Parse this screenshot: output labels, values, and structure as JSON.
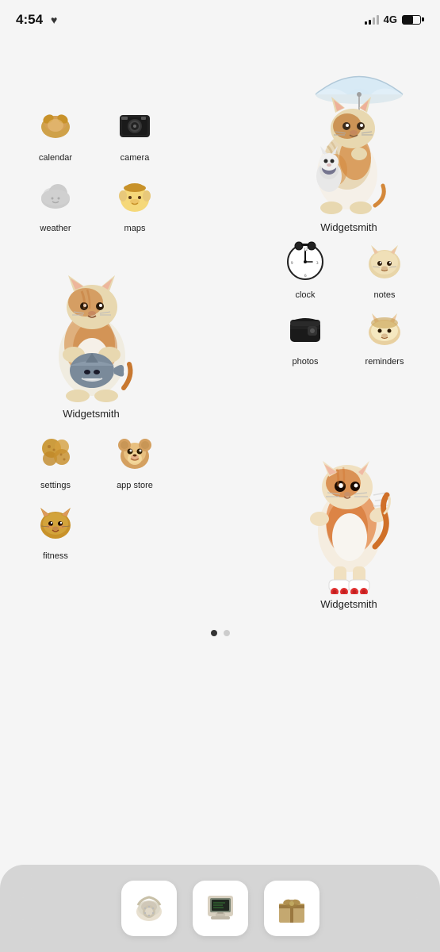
{
  "statusBar": {
    "time": "4:54",
    "heart": "♥",
    "network": "4G"
  },
  "section1": {
    "apps": [
      {
        "id": "calendar",
        "label": "calendar",
        "emoji": "🥐"
      },
      {
        "id": "camera",
        "label": "camera",
        "emoji": "📷"
      }
    ],
    "weatherMaps": [
      {
        "id": "weather",
        "label": "weather",
        "emoji": "☁️"
      },
      {
        "id": "maps",
        "label": "maps",
        "emoji": "🐶"
      }
    ],
    "widgetsmith1": {
      "label": "Widgetsmith"
    }
  },
  "section2": {
    "widgetsmith2": {
      "label": "Widgetsmith"
    },
    "apps": [
      {
        "id": "clock",
        "label": "clock",
        "emoji": "⏰"
      },
      {
        "id": "notes",
        "label": "notes",
        "emoji": "🐱"
      },
      {
        "id": "photos",
        "label": "photos",
        "emoji": "👛"
      },
      {
        "id": "reminders",
        "label": "reminders",
        "emoji": "🍞"
      }
    ]
  },
  "section3": {
    "apps": [
      {
        "id": "settings",
        "label": "settings",
        "emoji": "🧸"
      },
      {
        "id": "app-store",
        "label": "app store",
        "emoji": "🧸"
      },
      {
        "id": "fitness",
        "label": "fitness",
        "emoji": "🐱"
      }
    ],
    "widgetsmith3": {
      "label": "Widgetsmith"
    }
  },
  "dock": {
    "apps": [
      {
        "id": "phone",
        "label": "phone",
        "emoji": "☎️"
      },
      {
        "id": "computer",
        "label": "computer",
        "emoji": "🖥️"
      },
      {
        "id": "gifts",
        "label": "gifts",
        "emoji": "📦"
      }
    ]
  },
  "pageDots": {
    "active": 0,
    "total": 2
  }
}
